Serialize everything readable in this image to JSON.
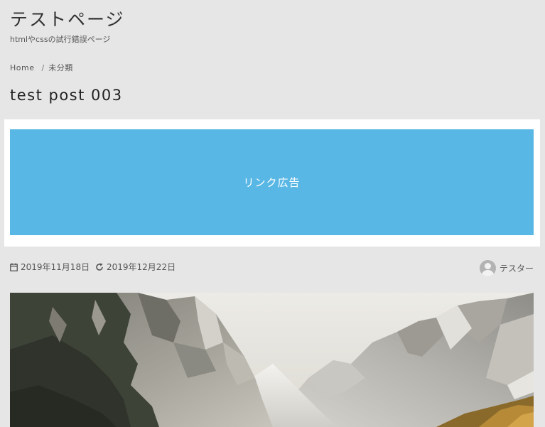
{
  "site": {
    "title": "テストページ",
    "description": "htmlやcssの試行錯誤ページ"
  },
  "breadcrumb": {
    "home": "Home",
    "separator": "/",
    "category": "未分類"
  },
  "post": {
    "title": "test post 003",
    "published": "2019年11月18日",
    "updated": "2019年12月22日",
    "author": "テスター"
  },
  "ad": {
    "label": "リンク広告"
  },
  "colors": {
    "background": "#e6e6e6",
    "ad_background": "#58b7e4",
    "ad_frame": "#ffffff"
  },
  "icons": {
    "published": "calendar-icon",
    "updated": "refresh-icon",
    "author": "avatar"
  },
  "hero_image": {
    "subject": "mountain-landscape-photo"
  }
}
